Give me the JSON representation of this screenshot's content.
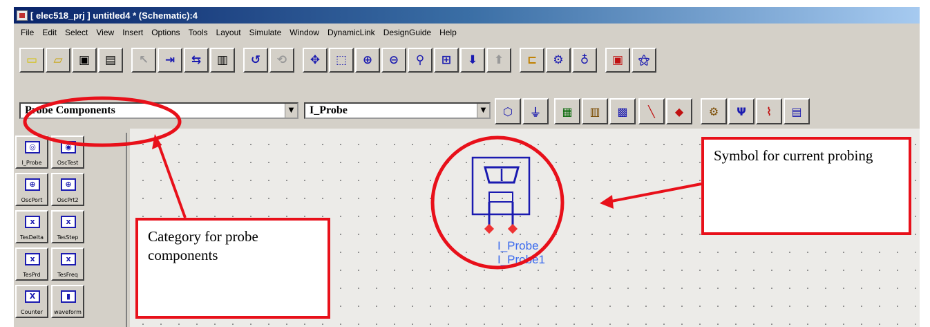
{
  "window": {
    "title": "[ elec518_prj ] untitled4 * (Schematic):4"
  },
  "menu": [
    "File",
    "Edit",
    "Select",
    "View",
    "Insert",
    "Options",
    "Tools",
    "Layout",
    "Simulate",
    "Window",
    "DynamicLink",
    "DesignGuide",
    "Help"
  ],
  "toolbar": {
    "icons": [
      "new-icon",
      "open-icon",
      "save-icon",
      "print-icon",
      "select-arrow-icon",
      "insert-pin-icon",
      "insert-port-icon",
      "delete-icon",
      "undo-icon",
      "rotate-icon",
      "move-icon",
      "zoom-area-icon",
      "zoom-in-icon",
      "zoom-out-icon",
      "zoom-point-icon",
      "fit-view-icon",
      "push-down-icon",
      "pop-up-icon",
      "wire-icon",
      "simulate-icon",
      "tuning-icon",
      "options-icon",
      "tune-wand-icon"
    ]
  },
  "palette": {
    "category": "Probe Components",
    "component_search": "I_Probe",
    "items": [
      {
        "label": "I_Probe",
        "glyph": "◎"
      },
      {
        "label": "OscTest",
        "glyph": "◉"
      },
      {
        "label": "OscPort",
        "glyph": "⊕"
      },
      {
        "label": "OscPrt2",
        "glyph": "⊕"
      },
      {
        "label": "TesDelta",
        "glyph": "x"
      },
      {
        "label": "TesStep",
        "glyph": "x"
      },
      {
        "label": "TesPrd",
        "glyph": "x"
      },
      {
        "label": "TesFreq",
        "glyph": "x"
      },
      {
        "label": "Counter",
        "glyph": "X"
      },
      {
        "label": "waveform",
        "glyph": "▮"
      }
    ]
  },
  "schematic": {
    "probe_type": "I_Probe",
    "probe_instance": "I_Probe1"
  },
  "annotations": {
    "category_text": "Category for probe components",
    "symbol_text": "Symbol for current probing",
    "highlight_color": "#e8101a"
  }
}
